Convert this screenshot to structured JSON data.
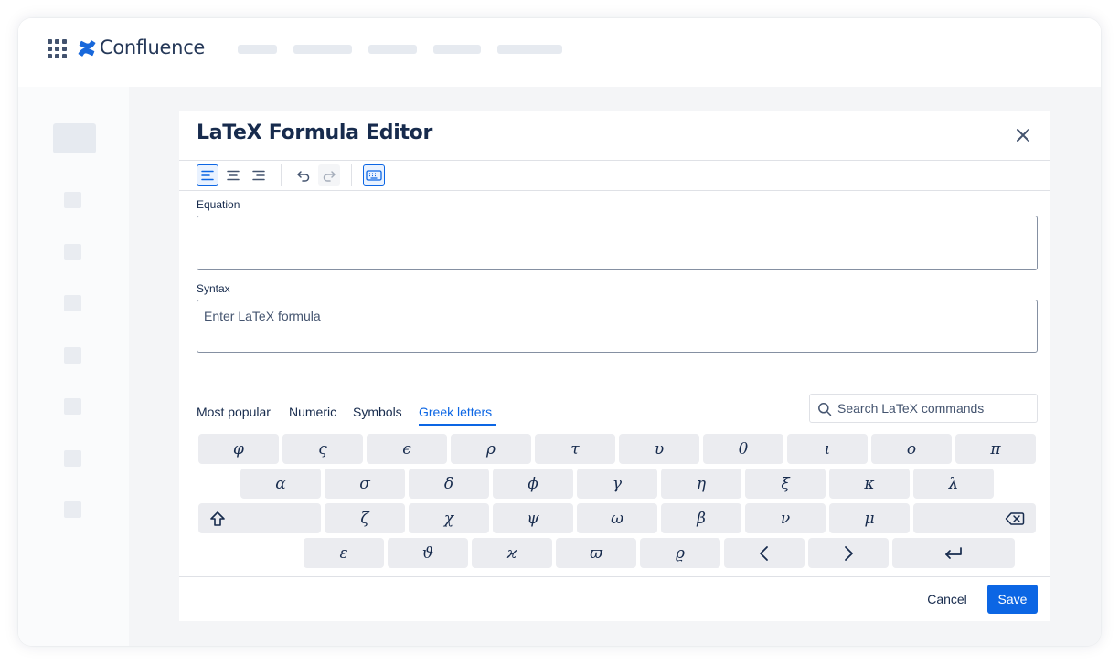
{
  "app": {
    "name": "Confluence",
    "brand_color": "#0c66e4"
  },
  "dialog": {
    "title": "LaTeX Formula Editor",
    "close_icon": "close-icon"
  },
  "toolbar": {
    "buttons": [
      {
        "name": "align-left",
        "icon": "align-left-icon",
        "state": "active"
      },
      {
        "name": "align-center",
        "icon": "align-center-icon",
        "state": "normal"
      },
      {
        "name": "align-right",
        "icon": "align-right-icon",
        "state": "normal"
      },
      {
        "name": "undo",
        "icon": "undo-icon",
        "state": "normal"
      },
      {
        "name": "redo",
        "icon": "redo-icon",
        "state": "disabled"
      },
      {
        "name": "keyboard",
        "icon": "keyboard-icon",
        "state": "active"
      }
    ]
  },
  "equation": {
    "label": "Equation",
    "value": ""
  },
  "syntax": {
    "label": "Syntax",
    "placeholder": "Enter LaTeX formula",
    "value": ""
  },
  "tabs": {
    "items": [
      "Most popular",
      "Numeric",
      "Symbols",
      "Greek letters"
    ],
    "active": "Greek letters"
  },
  "search": {
    "placeholder": "Search LaTeX commands",
    "value": ""
  },
  "keyboard": {
    "row1": [
      "φ",
      "ς",
      "ϵ",
      "ρ",
      "τ",
      "υ",
      "θ",
      "ι",
      "ο",
      "π"
    ],
    "row2": [
      "α",
      "σ",
      "δ",
      "ϕ",
      "γ",
      "η",
      "ξ",
      "κ",
      "λ"
    ],
    "row3": [
      "ζ",
      "χ",
      "ψ",
      "ω",
      "β",
      "ν",
      "μ"
    ],
    "row4": [
      "ε",
      "ϑ",
      "ϰ",
      "ϖ",
      "ϱ"
    ],
    "special_icons": [
      "shift-icon",
      "backspace-icon",
      "arrow-left-icon",
      "arrow-right-icon",
      "enter-icon"
    ]
  },
  "footer": {
    "cancel_label": "Cancel",
    "save_label": "Save"
  }
}
